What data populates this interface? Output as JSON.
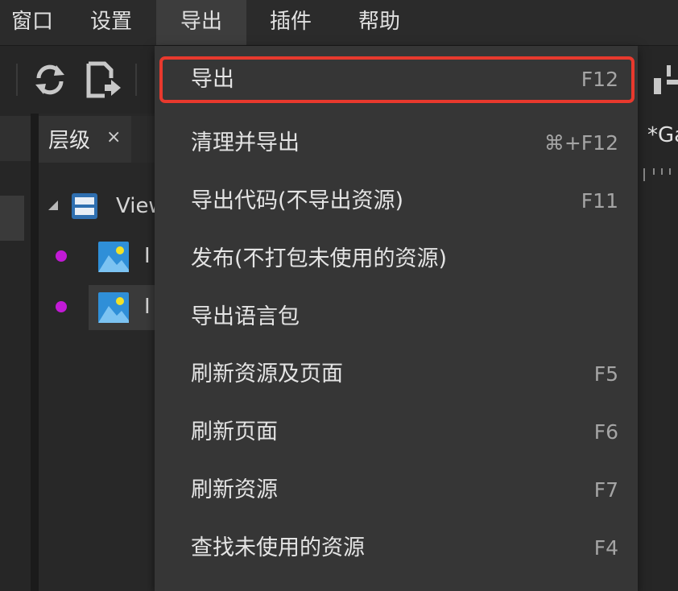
{
  "menubar": {
    "items": [
      {
        "label": "窗口"
      },
      {
        "label": "设置"
      },
      {
        "label": "导出"
      },
      {
        "label": "插件"
      },
      {
        "label": "帮助"
      }
    ],
    "active_index": 2
  },
  "toolbar": {
    "icons": [
      "refresh-icon",
      "export-file-icon",
      "align-icon"
    ]
  },
  "hierarchy": {
    "tab_title": "层级",
    "close_glyph": "×",
    "items": [
      {
        "label": "View",
        "icon": "view-container-icon",
        "expander": "▲"
      },
      {
        "label": "I",
        "icon": "image-icon",
        "dot_color": "#c21ad6"
      },
      {
        "label": "I",
        "icon": "image-icon",
        "dot_color": "#c21ad6"
      }
    ]
  },
  "scene": {
    "title": "*Ga"
  },
  "dropdown": {
    "items": [
      {
        "label": "导出",
        "shortcut": "F12",
        "highlighted": true
      },
      {
        "label": "清理并导出",
        "shortcut": "⌘+F12"
      },
      {
        "label": "导出代码(不导出资源)",
        "shortcut": "F11"
      },
      {
        "label": "发布(不打包未使用的资源)",
        "shortcut": ""
      },
      {
        "label": "导出语言包",
        "shortcut": ""
      },
      {
        "label": "刷新资源及页面",
        "shortcut": "F5"
      },
      {
        "label": "刷新页面",
        "shortcut": "F6"
      },
      {
        "label": "刷新资源",
        "shortcut": "F7"
      },
      {
        "label": "查找未使用的资源",
        "shortcut": "F4"
      }
    ]
  },
  "colors": {
    "highlight_border": "#e8392d",
    "dot": "#c21ad6",
    "image_icon_bg": "#2f8fd8",
    "image_icon_sun": "#f3e227"
  }
}
